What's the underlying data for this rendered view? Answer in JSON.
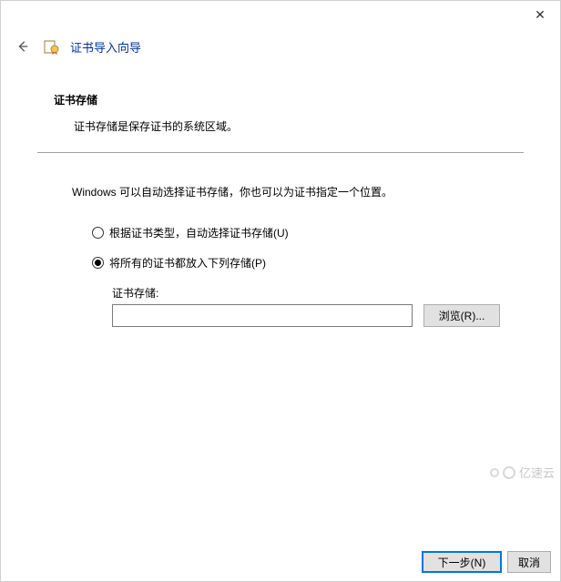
{
  "titlebar": {
    "close": "✕"
  },
  "header": {
    "wizard_title": "证书导入向导"
  },
  "section": {
    "title": "证书存储",
    "description": "证书存储是保存证书的系统区域。"
  },
  "body": {
    "helper": "Windows 可以自动选择证书存储，你也可以为证书指定一个位置。",
    "radio_auto": "根据证书类型，自动选择证书存储(U)",
    "radio_manual": "将所有的证书都放入下列存储(P)",
    "store_label": "证书存储:",
    "store_value": "",
    "browse": "浏览(R)..."
  },
  "footer": {
    "next": "下一步(N)",
    "cancel": "取消"
  },
  "watermark": "亿速云"
}
